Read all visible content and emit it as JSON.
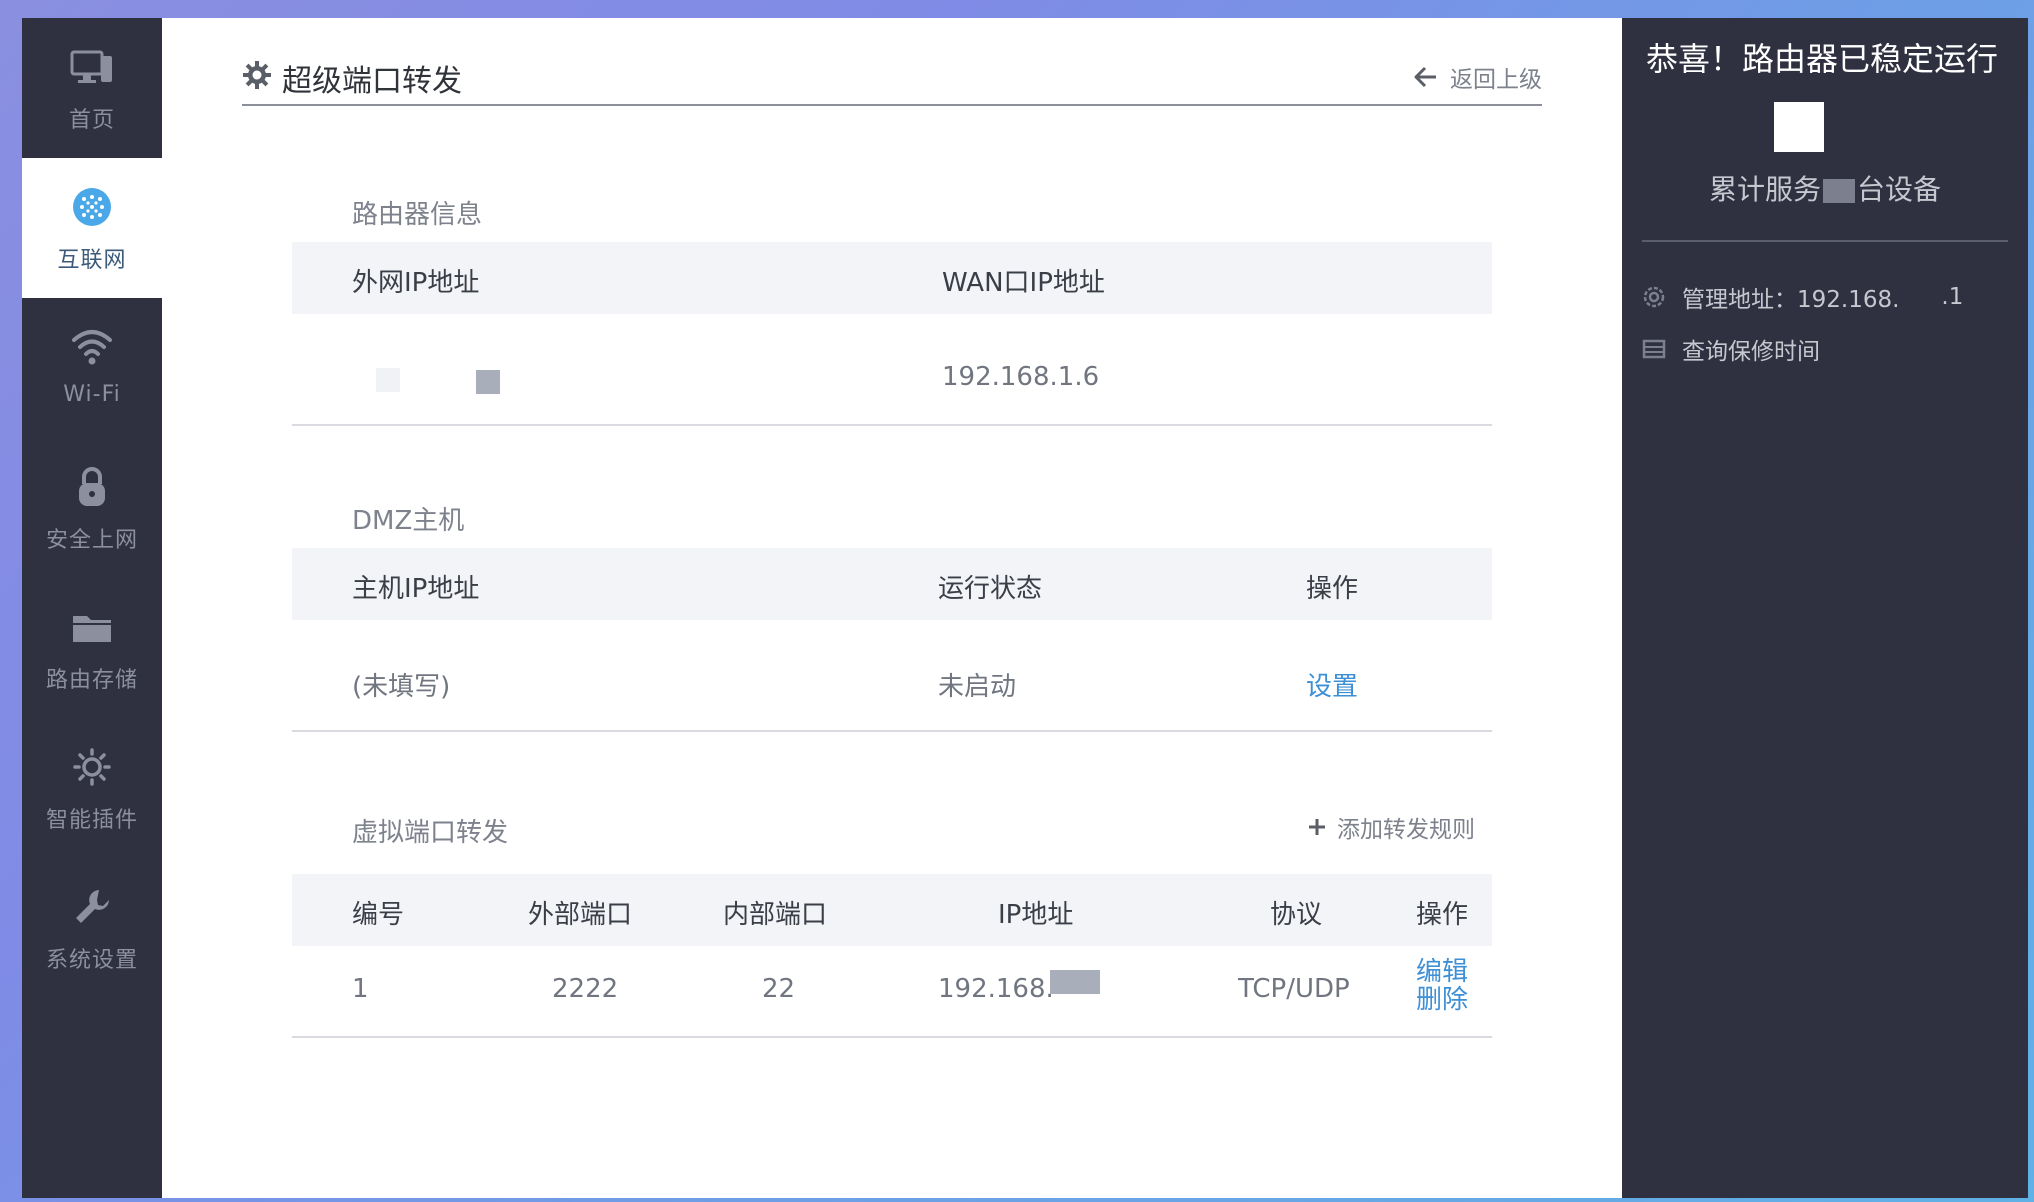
{
  "colors": {
    "nav_bg": "#2f3040",
    "accent_link": "#3d8fd6",
    "header_bg": "#f3f4f8",
    "muted_text": "#7d828c"
  },
  "nav": {
    "items": [
      {
        "label": "首页",
        "icon": "monitor-icon"
      },
      {
        "label": "互联网",
        "icon": "globe-icon",
        "active": true
      },
      {
        "label": "Wi-Fi",
        "icon": "wifi-icon"
      },
      {
        "label": "安全上网",
        "icon": "lock-icon"
      },
      {
        "label": "路由存储",
        "icon": "folder-icon"
      },
      {
        "label": "智能插件",
        "icon": "sun-gear-icon"
      },
      {
        "label": "系统设置",
        "icon": "wrench-icon"
      }
    ]
  },
  "page": {
    "title": "超级端口转发",
    "back_label": "返回上级"
  },
  "router_info": {
    "section_title": "路由器信息",
    "columns": [
      "外网IP地址",
      "WAN口IP地址"
    ],
    "wan_ip": "192.168.1.6"
  },
  "dmz": {
    "section_title": "DMZ主机",
    "columns": [
      "主机IP地址",
      "运行状态",
      "操作"
    ],
    "host_ip": "(未填写)",
    "status": "未启动",
    "action": "设置"
  },
  "port_forward": {
    "section_title": "虚拟端口转发",
    "add_label": "添加转发规则",
    "columns": [
      "编号",
      "外部端口",
      "内部端口",
      "IP地址",
      "协议",
      "操作"
    ],
    "rows": [
      {
        "id": "1",
        "ext_port": "2222",
        "int_port": "22",
        "ip": "192.168.",
        "protocol": "TCP/UDP",
        "edit": "编辑",
        "delete": "删除"
      }
    ]
  },
  "side": {
    "title": "恭喜！路由器已稳定运行",
    "served_prefix": "累计服务",
    "served_suffix": "台设备",
    "admin_label": "管理地址：192.168.",
    "admin_suffix": ".1",
    "warranty_label": "查询保修时间"
  }
}
